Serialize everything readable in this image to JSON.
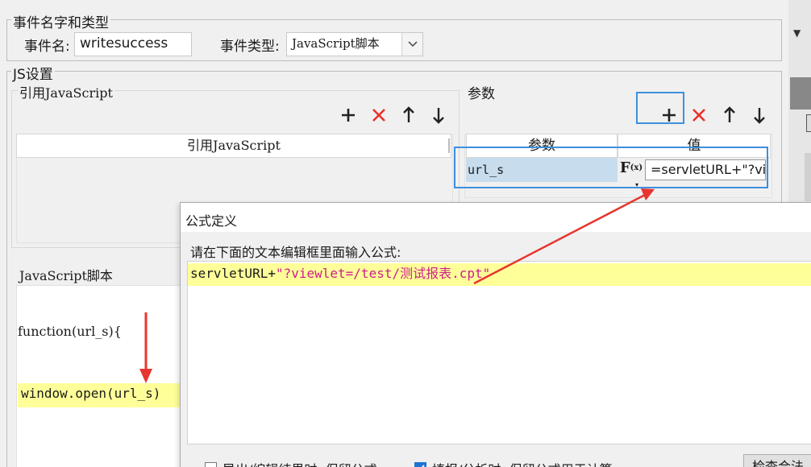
{
  "event_group": {
    "legend": "事件名字和类型",
    "name_label": "事件名:",
    "name_value": "writesuccess",
    "type_label": "事件类型:",
    "type_value": "JavaScript脚本"
  },
  "js_group": {
    "legend": "JS设置",
    "ref_section": {
      "title": "引用JavaScript",
      "column_header": "引用JavaScript"
    },
    "params_section": {
      "title": "参数",
      "columns": [
        "参数",
        "值"
      ],
      "rows": [
        {
          "name": "url_s",
          "value": "=servletURL+\"?vi"
        }
      ]
    },
    "script_section": {
      "title": "JavaScript脚本",
      "function_signature": "function(url_s){",
      "code_line": "window.open(url_s)"
    }
  },
  "icons": {
    "add": "plus-icon",
    "delete": "red-x-icon",
    "up": "arrow-up-icon",
    "down": "arrow-down-icon",
    "formula": "formula-fx-icon"
  },
  "formula_dialog": {
    "title": "公式定义",
    "instruction": "请在下面的文本编辑框里面输入公式:",
    "formula_ident": "servletURL+",
    "formula_string": "\"?viewlet=/test/测试报表.cpt\"",
    "option1": "导出/编辑结果时, 保留公式",
    "option2": "填报/分析时, 保留公式用于计算",
    "check_button": "检查合法"
  },
  "colors": {
    "highlight_line": "#ffff99",
    "selected_row": "#c7dcec",
    "annotation_blue": "#3d8fdb",
    "annotation_red": "#e8352f",
    "string_magenta": "#cc1e8c",
    "delete_red": "#e8312a"
  }
}
